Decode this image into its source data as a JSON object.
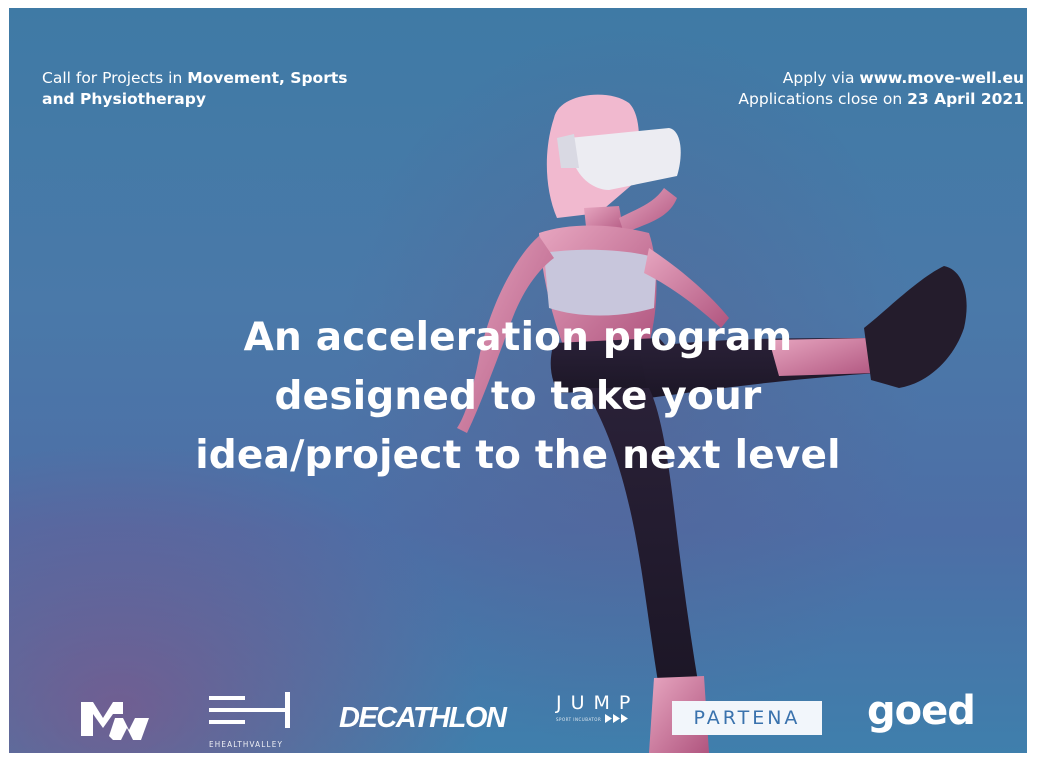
{
  "header": {
    "left_prefix": "Call for Projects in ",
    "left_bold_1": "Movement, Sports",
    "left_bold_2": "and Physiotherapy",
    "right_prefix": "Apply via ",
    "right_url": "www.move-well.eu",
    "right_line2_prefix": "Applications close on ",
    "right_date": "23 April 2021"
  },
  "headline": {
    "line1": "An acceleration program",
    "line2": "designed to take your",
    "line3": "idea/project to the next level"
  },
  "logos": {
    "ehealthvalley_caption": "EHEALTHVALLEY",
    "decathlon": "DECATHLON",
    "jump": "JUMP",
    "jump_sub": "SPORT INCUBATOR",
    "partena": "PARTENA",
    "goed": "goed"
  },
  "colors": {
    "background_top": "#3f7aa5",
    "background_mid": "#4d6ea6",
    "magenta_glow": "#96467d",
    "text": "#ffffff",
    "partena_blue": "#3a72ad"
  },
  "icons": {
    "mw_logo": "mw-logo-icon",
    "ehealthvalley_logo": "ehealthvalley-logo-icon",
    "jump_arrows": "triple-arrow-icon"
  }
}
